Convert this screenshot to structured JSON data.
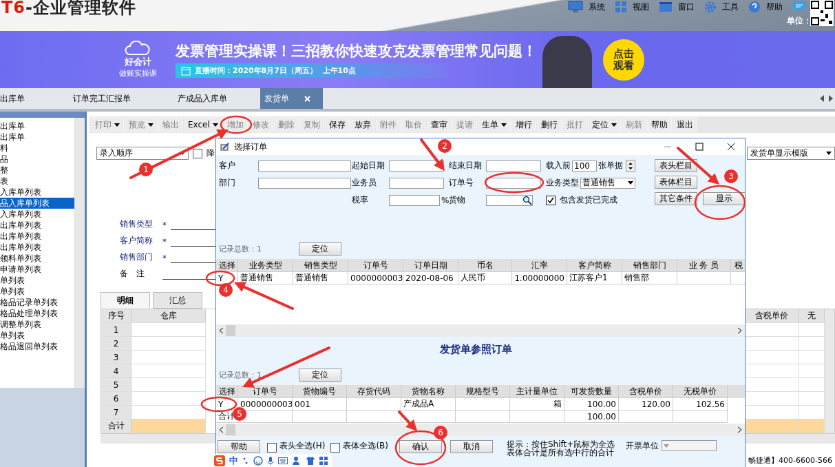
{
  "app": {
    "logo_mark": "T6",
    "logo_text": "-企业管理软件",
    "unit_label": "单位：",
    "menu": [
      {
        "label": "系统",
        "kind": "monitor"
      },
      {
        "label": "视图",
        "kind": "grid"
      },
      {
        "label": "窗口",
        "kind": "window"
      },
      {
        "label": "工具",
        "kind": "gear"
      },
      {
        "label": "帮助",
        "kind": "help"
      }
    ]
  },
  "banner": {
    "brand": "好会计",
    "subtitle": "做账实操课",
    "headline": "发票管理实操课！三招教你快速攻克发票管理常见问题！",
    "schedule": "直播时间：2020年8月7日（周五）  上午10点",
    "cta": "点击观看"
  },
  "tabs": [
    {
      "label": "出库单",
      "selected": false,
      "closable": false
    },
    {
      "label": "订单完工汇报单",
      "selected": false,
      "closable": false
    },
    {
      "label": "产成品入库单",
      "selected": false,
      "closable": false
    },
    {
      "label": "发货单",
      "selected": true,
      "closable": true
    }
  ],
  "sidebar": {
    "items": [
      {
        "label": "出库单",
        "selected": false
      },
      {
        "label": "出库单",
        "selected": false
      },
      {
        "label": "料",
        "selected": false
      },
      {
        "label": "品",
        "selected": false
      },
      {
        "label": "整",
        "selected": false
      },
      {
        "label": "表",
        "selected": false
      },
      {
        "label": "入库单列表",
        "selected": false
      },
      {
        "label": "品入库单列表",
        "selected": true
      },
      {
        "label": "入库单列表",
        "selected": false
      },
      {
        "label": "出库单列表",
        "selected": false
      },
      {
        "label": "出库单列表",
        "selected": false
      },
      {
        "label": "出库单列表",
        "selected": false
      },
      {
        "label": "领料单列表",
        "selected": false
      },
      {
        "label": "申请单列表",
        "selected": false
      },
      {
        "label": "单列表",
        "selected": false
      },
      {
        "label": "单列表",
        "selected": false
      },
      {
        "label": "格品记录单列表",
        "selected": false
      },
      {
        "label": "格品处理单列表",
        "selected": false
      },
      {
        "label": "调整单列表",
        "selected": false
      },
      {
        "label": "单列表",
        "selected": false
      },
      {
        "label": "格品退回单列表",
        "selected": false
      }
    ]
  },
  "toolbar": [
    {
      "label": "打印",
      "dropdown": true,
      "disabled": true
    },
    {
      "label": "预览",
      "dropdown": true,
      "disabled": true
    },
    {
      "label": "输出",
      "dropdown": false,
      "disabled": true
    },
    {
      "label": "Excel",
      "dropdown": true,
      "disabled": false
    },
    {
      "label": "增加",
      "dropdown": false,
      "disabled": true
    },
    {
      "label": "修改",
      "dropdown": false,
      "disabled": true
    },
    {
      "label": "删除",
      "dropdown": false,
      "disabled": true
    },
    {
      "label": "复制",
      "dropdown": false,
      "disabled": true
    },
    {
      "label": "保存",
      "dropdown": false,
      "disabled": false
    },
    {
      "label": "放弃",
      "dropdown": false,
      "disabled": false
    },
    {
      "label": "附件",
      "dropdown": false,
      "disabled": true
    },
    {
      "label": "取价",
      "dropdown": false,
      "disabled": true
    },
    {
      "label": "查审",
      "dropdown": false,
      "disabled": false
    },
    {
      "label": "提请",
      "dropdown": false,
      "disabled": true
    },
    {
      "label": "生单",
      "dropdown": true,
      "disabled": false
    },
    {
      "label": "增行",
      "dropdown": false,
      "disabled": false
    },
    {
      "label": "删行",
      "dropdown": false,
      "disabled": false
    },
    {
      "label": "批打",
      "dropdown": false,
      "disabled": true
    },
    {
      "label": "定位",
      "dropdown": true,
      "disabled": false
    },
    {
      "label": "刷新",
      "dropdown": false,
      "disabled": true
    },
    {
      "label": "帮助",
      "dropdown": false,
      "disabled": false
    },
    {
      "label": "退出",
      "dropdown": false,
      "disabled": false
    }
  ],
  "form": {
    "sort": "录入顺序",
    "descending": {
      "label": "降",
      "checked": false
    },
    "template": "发货单显示模版",
    "fields": [
      {
        "label": "销售类型",
        "required_mark": "*"
      },
      {
        "label": "客户简称",
        "required_mark": "*"
      },
      {
        "label": "销售部门",
        "required_mark": "*"
      },
      {
        "label": "备　注"
      }
    ]
  },
  "detail_tabs": [
    {
      "label": "明细",
      "selected": true
    },
    {
      "label": "汇总",
      "selected": false
    }
  ],
  "grid": {
    "columns_left": [
      "序号",
      "仓库"
    ],
    "columns_right": [
      "含税单价",
      "无"
    ],
    "row_numbers": [
      "1",
      "2",
      "3",
      "4",
      "5",
      "6",
      "7"
    ],
    "total_label": "合计"
  },
  "status_bar": {
    "text": "畅捷通】400-6600-566"
  },
  "dialog": {
    "title": "选择订单",
    "filter_rows": [
      [
        {
          "kind": "input",
          "label": "客户"
        },
        {
          "kind": "input",
          "label": "起始日期"
        },
        {
          "kind": "input",
          "label": "结束日期"
        },
        {
          "kind": "spin",
          "label": "载入前",
          "value": "100",
          "suffix": "张单据"
        }
      ],
      [
        {
          "kind": "input",
          "label": "部门"
        },
        {
          "kind": "input",
          "label": "业务员"
        },
        {
          "kind": "input",
          "label": "订单号"
        },
        {
          "kind": "select",
          "label": "业务类型",
          "value": "普通销售"
        }
      ],
      [
        {
          "kind": "input",
          "label": "税率",
          "suffix": "%"
        },
        {
          "kind": "lookup",
          "label": "货物"
        },
        {
          "kind": "check",
          "label": "包含发货已完成",
          "checked": true
        }
      ]
    ],
    "side_buttons": [
      "表头栏目",
      "表体栏目",
      "其它条件",
      "显示"
    ],
    "orders": {
      "record_count": "记录总数：1",
      "locate": "定位",
      "columns": [
        "选择",
        "业务类型",
        "销售类型",
        "订单号",
        "订单日期",
        "币名",
        "汇率",
        "客户简称",
        "销售部门",
        "业 务 员",
        "税"
      ],
      "rows": [
        [
          "Y",
          "普通销售",
          "普通销售",
          "0000000003",
          "2020-08-06",
          "人民币",
          "1.00000000",
          "江苏客户1",
          "销售部",
          "",
          ""
        ]
      ]
    },
    "section_title": "发货单参照订单",
    "lines": {
      "record_count": "记录总数：1",
      "locate": "定位",
      "columns": [
        "选择",
        "订单号",
        "货物编号",
        "存货代码",
        "货物名称",
        "规格型号",
        "主计量单位",
        "可发货数量",
        "含税单价",
        "无税单价"
      ],
      "rows": [
        [
          "Y",
          "0000000003",
          "001",
          "",
          "产成品A",
          "",
          "箱",
          "100.00",
          "120.00",
          "102.56"
        ]
      ],
      "total": {
        "label": "合计",
        "quantity": "100.00"
      }
    },
    "footer": {
      "help": "帮助",
      "checks": [
        {
          "label": "表头全选(H)",
          "checked": false
        },
        {
          "label": "表体全选(B)",
          "checked": false
        }
      ],
      "confirm": "确认",
      "cancel": "取消",
      "hint": [
        "提示：按住Shift+鼠标为全选",
        "表体合计是所有选中行的合计"
      ],
      "invoice_label": "开票单位"
    }
  },
  "ime": {
    "mode": "中"
  },
  "annotations": [
    {
      "number": "1"
    },
    {
      "number": "2"
    },
    {
      "number": "3"
    },
    {
      "number": "4"
    },
    {
      "number": "5"
    },
    {
      "number": "6"
    }
  ]
}
